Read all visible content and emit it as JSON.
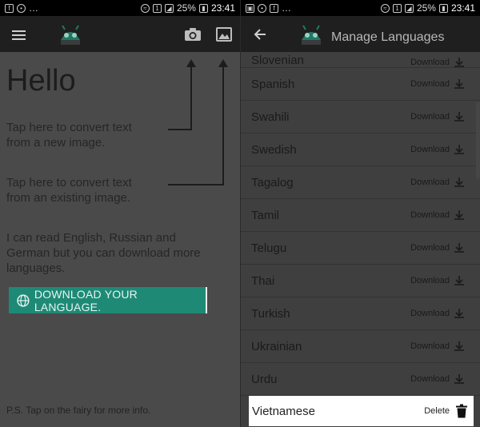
{
  "left": {
    "status": {
      "battery": "25%",
      "time": "23:41"
    },
    "hello": "Hello",
    "tip_new_line1": "Tap here to convert text",
    "tip_new_line2": "from a new image.",
    "tip_existing_line1": "Tap here to convert text",
    "tip_existing_line2": "from an existing image.",
    "tip_languages_line1": "I can read English, Russian and",
    "tip_languages_line2": "German but you can download more",
    "tip_languages_line3": "languages.",
    "download_button": "DOWNLOAD YOUR LANGUAGE.",
    "ps": "P.S. Tap on the fairy for more info."
  },
  "right": {
    "status": {
      "battery": "25%",
      "time": "23:41"
    },
    "title": "Manage Languages",
    "partial_row": {
      "language": "Slovenian",
      "action": "Download"
    },
    "languages": [
      {
        "name": "Spanish",
        "action": "Download"
      },
      {
        "name": "Swahili",
        "action": "Download"
      },
      {
        "name": "Swedish",
        "action": "Download"
      },
      {
        "name": "Tagalog",
        "action": "Download"
      },
      {
        "name": "Tamil",
        "action": "Download"
      },
      {
        "name": "Telugu",
        "action": "Download"
      },
      {
        "name": "Thai",
        "action": "Download"
      },
      {
        "name": "Turkish",
        "action": "Download"
      },
      {
        "name": "Ukrainian",
        "action": "Download"
      },
      {
        "name": "Urdu",
        "action": "Download"
      }
    ],
    "selected": {
      "name": "Vietnamese",
      "action": "Delete"
    }
  },
  "icons": {
    "menu": "hamburger-icon",
    "camera": "camera-icon",
    "gallery": "image-icon",
    "back": "arrow-back-icon",
    "download": "download-icon",
    "delete": "trash-icon",
    "globe": "globe-icon",
    "mascot": "android-fairy-icon"
  },
  "colors": {
    "accent": "#1e8a76",
    "toolbar": "#1f1f1f",
    "overlay_background": "#4a4a4a"
  }
}
